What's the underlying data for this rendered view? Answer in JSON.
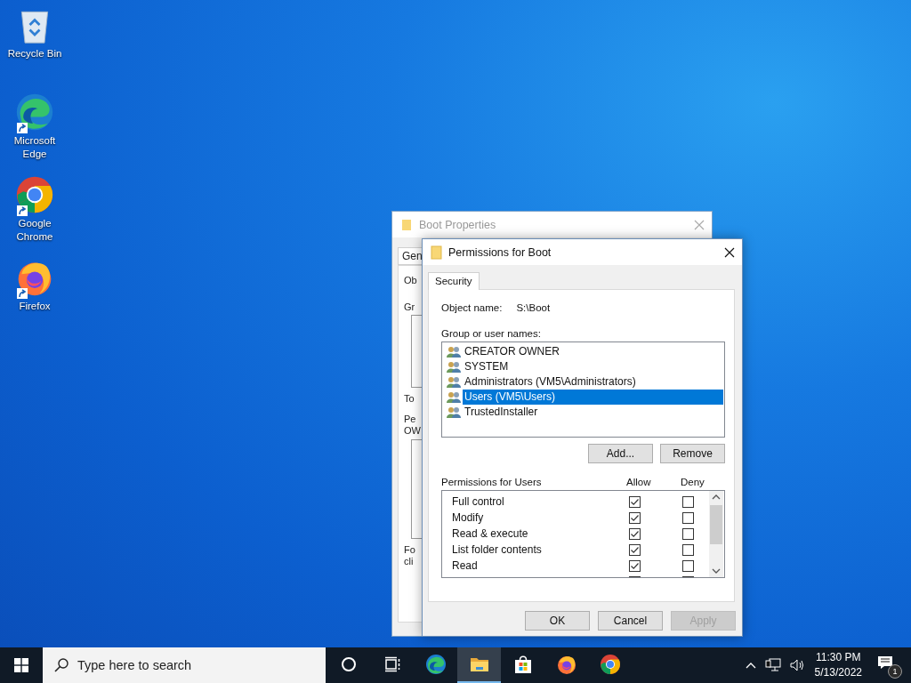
{
  "desktop_icons": [
    {
      "label": "Recycle Bin",
      "kind": "recycle-bin",
      "shortcut": false
    },
    {
      "label": "Microsoft Edge",
      "kind": "edge",
      "shortcut": true
    },
    {
      "label": "Google Chrome",
      "kind": "chrome",
      "shortcut": true
    },
    {
      "label": "Firefox",
      "kind": "firefox",
      "shortcut": true
    }
  ],
  "back_window": {
    "title": "Boot Properties",
    "tab": "Gen",
    "fragments": [
      "Ob",
      "Gr",
      "To",
      "Pe",
      "OW",
      "Fo",
      "cli"
    ]
  },
  "dialog": {
    "title": "Permissions for Boot",
    "tabs": [
      {
        "label": "Security",
        "selected": true
      }
    ],
    "object_name_label": "Object name:",
    "object_name": "S:\\Boot",
    "group_label": "Group or user names:",
    "principals": [
      {
        "name": "CREATOR OWNER",
        "selected": false
      },
      {
        "name": "SYSTEM",
        "selected": false
      },
      {
        "name": "Administrators (VM5\\Administrators)",
        "selected": false
      },
      {
        "name": "Users (VM5\\Users)",
        "selected": true
      },
      {
        "name": "TrustedInstaller",
        "selected": false
      }
    ],
    "list_buttons": [
      "Add...",
      "Remove"
    ],
    "permissions_label": "Permissions for Users",
    "allow_label": "Allow",
    "deny_label": "Deny",
    "permissions": [
      {
        "name": "Full control",
        "allow": true,
        "deny": false
      },
      {
        "name": "Modify",
        "allow": true,
        "deny": false
      },
      {
        "name": "Read & execute",
        "allow": true,
        "deny": false
      },
      {
        "name": "List folder contents",
        "allow": true,
        "deny": false
      },
      {
        "name": "Read",
        "allow": true,
        "deny": false
      }
    ],
    "footer_buttons": [
      {
        "label": "OK",
        "disabled": false
      },
      {
        "label": "Cancel",
        "disabled": false
      },
      {
        "label": "Apply",
        "disabled": true
      }
    ]
  },
  "taskbar": {
    "search_placeholder": "Type here to search",
    "apps": [
      {
        "kind": "cortana",
        "active": false
      },
      {
        "kind": "task-view",
        "active": false
      },
      {
        "kind": "edge",
        "active": false
      },
      {
        "kind": "explorer",
        "active": true
      },
      {
        "kind": "store",
        "active": false
      },
      {
        "kind": "firefox",
        "active": false
      },
      {
        "kind": "chrome",
        "active": false
      }
    ],
    "time": "11:30 PM",
    "date": "5/13/2022",
    "notifications": "1"
  }
}
